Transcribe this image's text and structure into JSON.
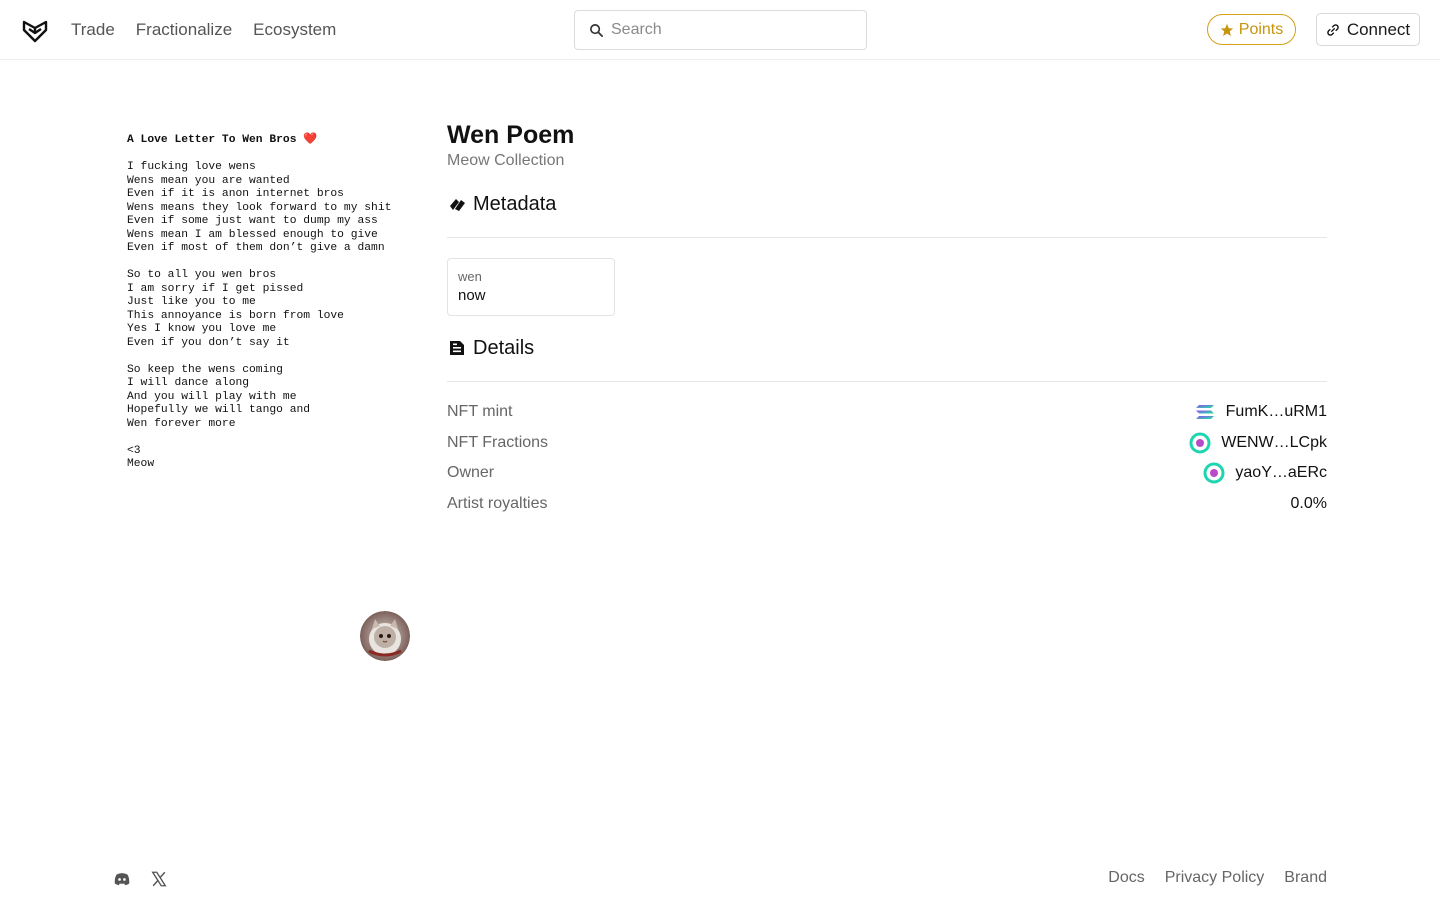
{
  "header": {
    "nav": [
      "Trade",
      "Fractionalize",
      "Ecosystem"
    ],
    "search_placeholder": "Search",
    "points_label": "Points",
    "connect_label": "Connect"
  },
  "poem": {
    "title": "A Love Letter To Wen Bros",
    "stanzas": [
      [
        "I fucking love wens",
        "Wens mean you are wanted",
        "Even if it is anon internet bros",
        "Wens means they look forward to my shit",
        "Even if some just want to dump my ass",
        "Wens mean I am blessed enough to give",
        "Even if most of them don’t give a damn"
      ],
      [
        "So to all you wen bros",
        "I am sorry if I get pissed",
        "Just like you to me",
        "This annoyance is born from love",
        "Yes I know you love me",
        "Even if you don’t say it"
      ],
      [
        "So keep the wens coming",
        "I will dance along",
        "And you will play with me",
        "Hopefully we will tango and",
        "Wen forever more"
      ],
      [
        "<3",
        "Meow"
      ]
    ]
  },
  "nft": {
    "title": "Wen Poem",
    "collection": "Meow Collection"
  },
  "metadata": {
    "heading": "Metadata",
    "attributes": [
      {
        "key": "wen",
        "value": "now"
      }
    ]
  },
  "details": {
    "heading": "Details",
    "rows": [
      {
        "label": "NFT mint",
        "value": "FumK…uRM1",
        "icon": "solana-icon"
      },
      {
        "label": "NFT Fractions",
        "value": "WENW…LCpk",
        "icon": "token-icon"
      },
      {
        "label": "Owner",
        "value": "yaoY…aERc",
        "icon": "wallet-icon"
      },
      {
        "label": "Artist royalties",
        "value": "0.0%",
        "icon": ""
      }
    ]
  },
  "footer": {
    "links": [
      "Docs",
      "Privacy Policy",
      "Brand"
    ]
  },
  "colors": {
    "points": "#d4a017",
    "heart": "#d41a1a"
  }
}
